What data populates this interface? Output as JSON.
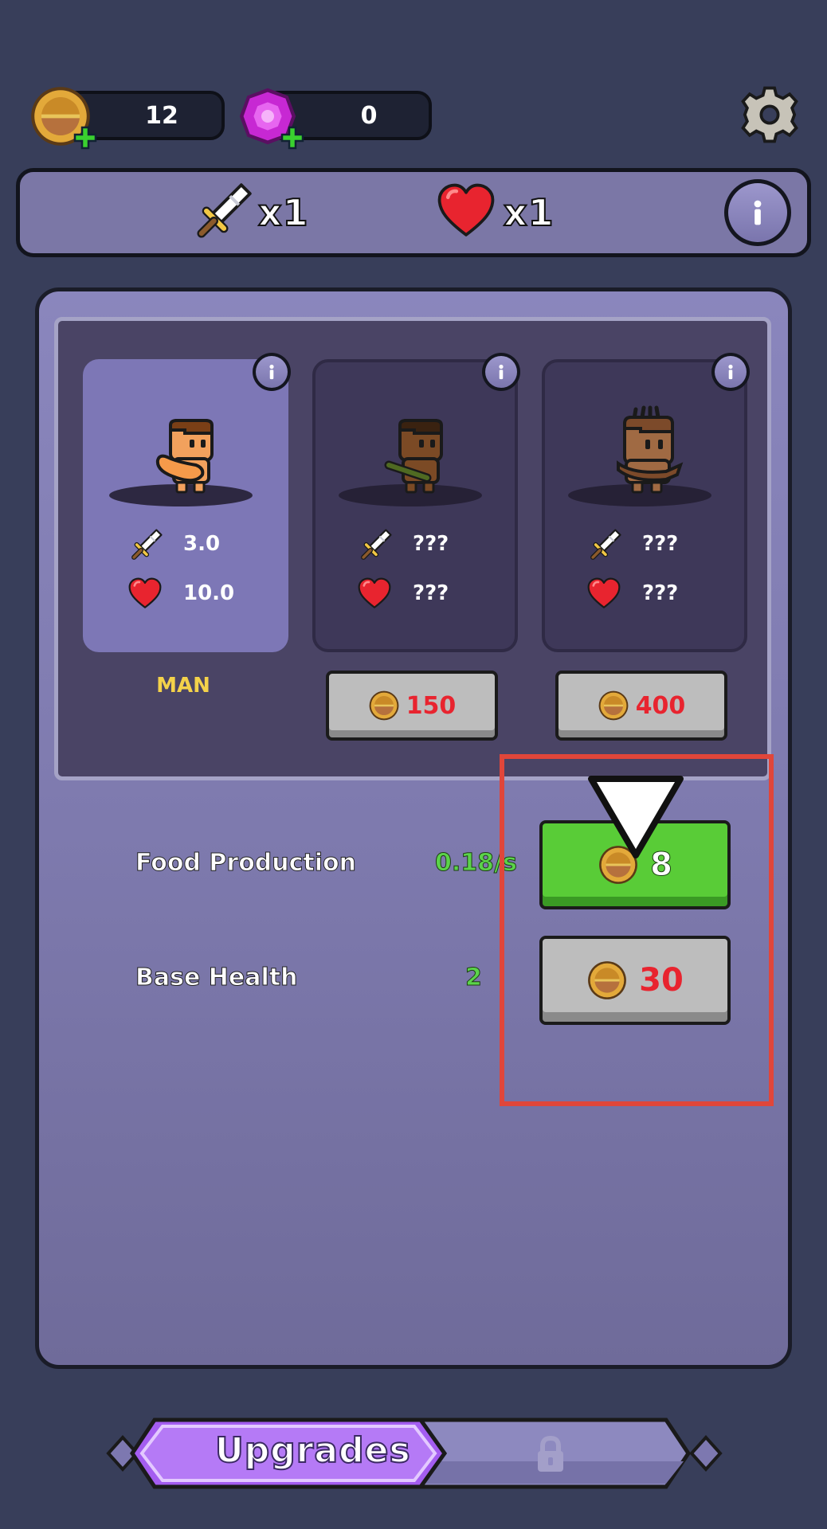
{
  "currencies": {
    "coins": {
      "value": "12",
      "icon": "coin-icon"
    },
    "gems": {
      "value": "0",
      "icon": "gem-icon"
    }
  },
  "stats": {
    "attack_multiplier": "x1",
    "health_multiplier": "x1"
  },
  "characters": [
    {
      "name": "MAN",
      "attack": "3.0",
      "health": "10.0",
      "state": "unlocked"
    },
    {
      "name": "",
      "attack": "???",
      "health": "???",
      "state": "locked",
      "price": "150"
    },
    {
      "name": "",
      "attack": "???",
      "health": "???",
      "state": "locked",
      "price": "400"
    }
  ],
  "upgrades": [
    {
      "label": "Food Production",
      "value": "0.18/s",
      "price": "8"
    },
    {
      "label": "Base Health",
      "value": "2",
      "price": "30"
    }
  ],
  "tabs": {
    "active": "Upgrades",
    "locked_icon": "lock-icon"
  },
  "colors": {
    "background": "#383e5a",
    "panel": "#8a86bd",
    "affordable": "#59cc37",
    "price_red": "#e8242f",
    "highlight": "#e0463a"
  }
}
